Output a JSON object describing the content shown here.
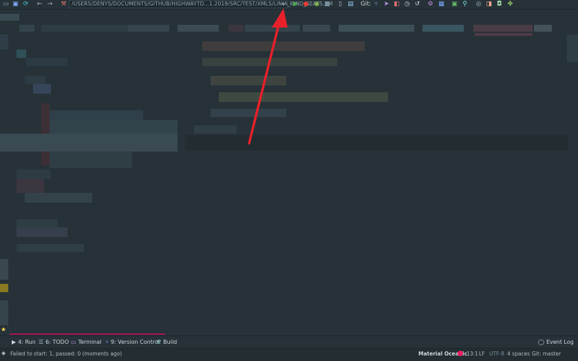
{
  "toolbar": {
    "run_config_path": "/USERS/DENYS/DOCUMENTS/GITHUB/HIGHWAYTD...1.2019/SRC/TEST/XMLS/LINIA_KINO_SEATS.XM",
    "git_label": "Git:",
    "icons": [
      "save-icon",
      "sync-icon",
      "back-arrow-icon",
      "forward-arrow-icon",
      "hammer-icon",
      "dropdown-arrow-icon",
      "run-icon",
      "debug-icon",
      "coverage-icon",
      "stop-icon",
      "device-icon",
      "sdk-icon",
      "vcs-update-icon",
      "vcs-commit-icon",
      "vcs-compare-icon",
      "vcs-history-icon",
      "vcs-revert-icon",
      "settings-icon",
      "structure-icon",
      "terminal-icon",
      "search-icon",
      "plugin-icon"
    ]
  },
  "annotation": {
    "color": "#e8202a"
  },
  "tool_windows": {
    "run": "4: Run",
    "todo": "6: TODO",
    "terminal": "Terminal",
    "version_control": "9: Version Control",
    "build": "Build",
    "event_log": "Event Log"
  },
  "status_bar": {
    "message": "Failed to start: 1, passed: 0 (moments ago)",
    "theme": "Material Oceanic",
    "position": "13:1",
    "line_separator": "LF",
    "encoding": "UTF-8",
    "indent": "4 spaces",
    "vcs_branch": "Git: master"
  },
  "colors": {
    "background": "#263238",
    "accent": "#e91e63",
    "run_green": "#4caf50",
    "debug_red": "#e53935"
  }
}
